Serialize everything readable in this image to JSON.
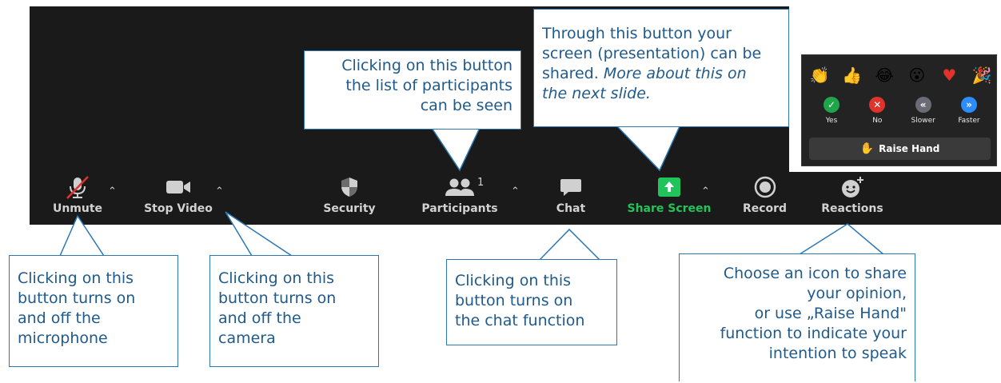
{
  "toolbar": {
    "unmute": "Unmute",
    "stop_video": "Stop Video",
    "security": "Security",
    "participants": "Participants",
    "participants_count": "1",
    "chat": "Chat",
    "share_screen": "Share Screen",
    "record": "Record",
    "reactions": "Reactions"
  },
  "reactions_panel": {
    "emojis": [
      "clapping-hands",
      "thumbs-up",
      "tears-of-joy",
      "open-mouth",
      "red-heart",
      "party-popper"
    ],
    "votes": [
      {
        "label": "Yes",
        "color": "#1fa64a",
        "glyph": "✓"
      },
      {
        "label": "No",
        "color": "#e0332c",
        "glyph": "✕"
      },
      {
        "label": "Slower",
        "color": "#6b6b75",
        "glyph": "«"
      },
      {
        "label": "Faster",
        "color": "#2d8cff",
        "glyph": "»"
      }
    ],
    "raise_hand": "Raise Hand"
  },
  "callouts": {
    "participants": [
      "Clicking on this button",
      "the list of participants",
      "can be seen"
    ],
    "share": [
      "Through this button your",
      "screen (presentation) can be",
      "shared. "
    ],
    "share_italic": [
      "More about this on",
      "the next slide."
    ],
    "mic": [
      "Clicking on this",
      "button turns on",
      "and off the",
      "microphone"
    ],
    "camera": [
      "Clicking on this",
      "button turns on",
      "and off the",
      "camera"
    ],
    "chat": [
      "Clicking on this",
      "button turns on",
      "the chat function"
    ],
    "reactions": [
      "Choose an icon to share",
      "your opinion,",
      "or use „Raise Hand\"",
      "function to indicate your",
      "intention to speak"
    ]
  },
  "colors": {
    "toolbar_bg": "#1a1a1a",
    "share_green": "#21c45a",
    "callout_border": "#2a78b4",
    "callout_text": "#1f5a8c"
  }
}
